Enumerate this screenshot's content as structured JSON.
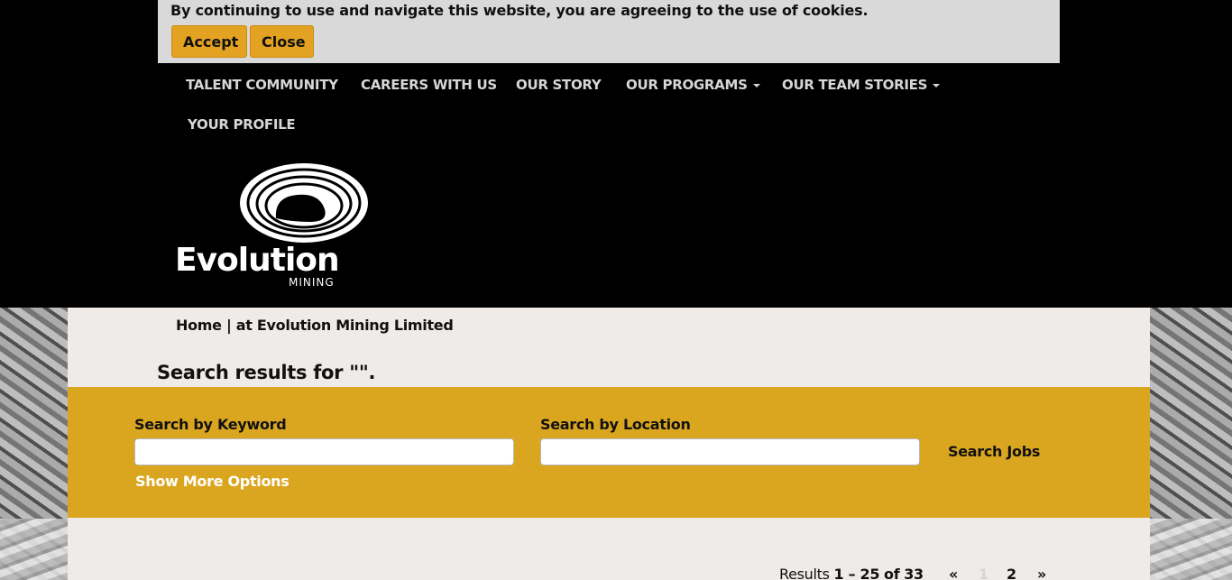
{
  "cookie_banner": {
    "text": "By continuing to use and navigate this website, you are agreeing to the use of cookies.",
    "accept_label": "Accept",
    "close_label": "Close"
  },
  "nav": {
    "items": [
      {
        "label": "TALENT COMMUNITY"
      },
      {
        "label": "CAREERS WITH US"
      },
      {
        "label": "OUR STORY"
      },
      {
        "label": "OUR PROGRAMS"
      },
      {
        "label": "OUR TEAM STORIES"
      },
      {
        "label": "YOUR PROFILE"
      }
    ]
  },
  "logo": {
    "name": "Evolution",
    "sub": "MINING"
  },
  "breadcrumb": "Home | at Evolution Mining Limited",
  "results_title": "Search results for \"\".",
  "search": {
    "keyword_label": "Search by Keyword",
    "keyword_value": "",
    "location_label": "Search by Location",
    "location_value": "",
    "search_button": "Search Jobs",
    "more_options": "Show More Options"
  },
  "pagination": {
    "results_prefix": "Results",
    "range": "1 – 25",
    "of_label": "of",
    "total": "33",
    "prev": "«",
    "pages": [
      "1",
      "2"
    ],
    "next": "»",
    "current_page": "1"
  },
  "colors": {
    "accent": "#dba61f",
    "button": "#e3a222",
    "banner_bg": "#d9d9d9",
    "content_bg": "#efebe8"
  }
}
